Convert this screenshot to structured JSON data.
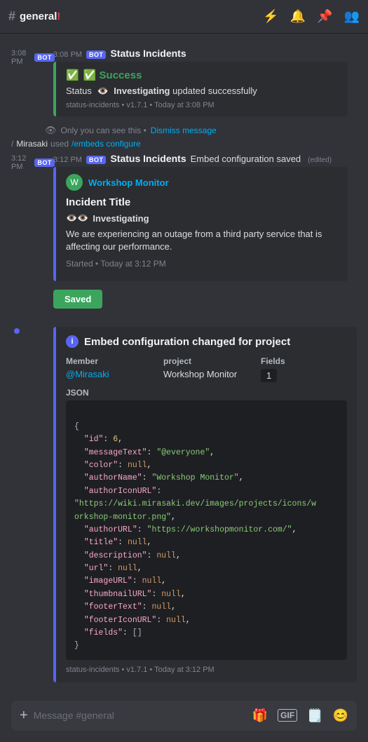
{
  "topbar": {
    "hash": "#",
    "channel_name": "general",
    "icons": [
      "filter-icon",
      "bell-icon",
      "pin-icon",
      "members-icon"
    ]
  },
  "messages": [
    {
      "id": "msg1",
      "time": "3:08 PM",
      "author": "Status Incidents",
      "is_bot": true,
      "embed_type": "success",
      "embed": {
        "title": "✅ Success",
        "status_label": "Status",
        "status_action": "Investigating",
        "status_detail": "updated successfully",
        "footer": "status-incidents • v1.7.1 • Today at 3:08 PM"
      }
    },
    {
      "id": "msg_system",
      "system_text": "Only you can see this •",
      "dismiss_text": "Dismiss message"
    },
    {
      "id": "msg_command",
      "slash": "/",
      "user": "Mirasaki",
      "used_text": "used",
      "command": "/embeds configure"
    },
    {
      "id": "msg2",
      "time": "3:12 PM",
      "author": "Status Incidents",
      "is_bot": true,
      "inline_label": "Embed configuration saved",
      "edited": "(edited)",
      "embed_type": "workshop",
      "embed": {
        "monitor_name": "Workshop Monitor",
        "title": "Incident Title",
        "investigating_label": "Investigating",
        "body": "We are experiencing an outage from a third party service that is affecting our performance.",
        "started": "Started • Today at 3:12 PM",
        "saved_button": "Saved"
      }
    },
    {
      "id": "msg3",
      "time": "",
      "author": "Status Incidents",
      "is_bot": true,
      "embed_type": "changed",
      "embed": {
        "title": "Embed configuration changed for project",
        "member_label": "Member",
        "member_value": "@Mirasaki",
        "project_label": "project",
        "project_value": "Workshop Monitor",
        "fields_label": "Fields",
        "fields_value": "1",
        "json_label": "JSON",
        "json_content": "{\n  \"id\": 6,\n  \"messageText\": \"@everyone\",\n  \"color\": null,\n  \"authorName\": \"Workshop Monitor\",\n  \"authorIconURL\":\n\"https://wiki.mirasaki.dev/images/projects/icons/w\norkshop-monitor.png\",\n  \"authorURL\": \"https://workshopmonitor.com/\",\n  \"title\": null,\n  \"description\": null,\n  \"url\": null,\n  \"imageURL\": null,\n  \"thumbnailURL\": null,\n  \"footerText\": null,\n  \"footerIconURL\": null,\n  \"fields\": []\n}",
        "footer": "status-incidents • v1.7.1 • Today at 3:12 PM"
      }
    }
  ],
  "input": {
    "placeholder": "Message #general"
  }
}
